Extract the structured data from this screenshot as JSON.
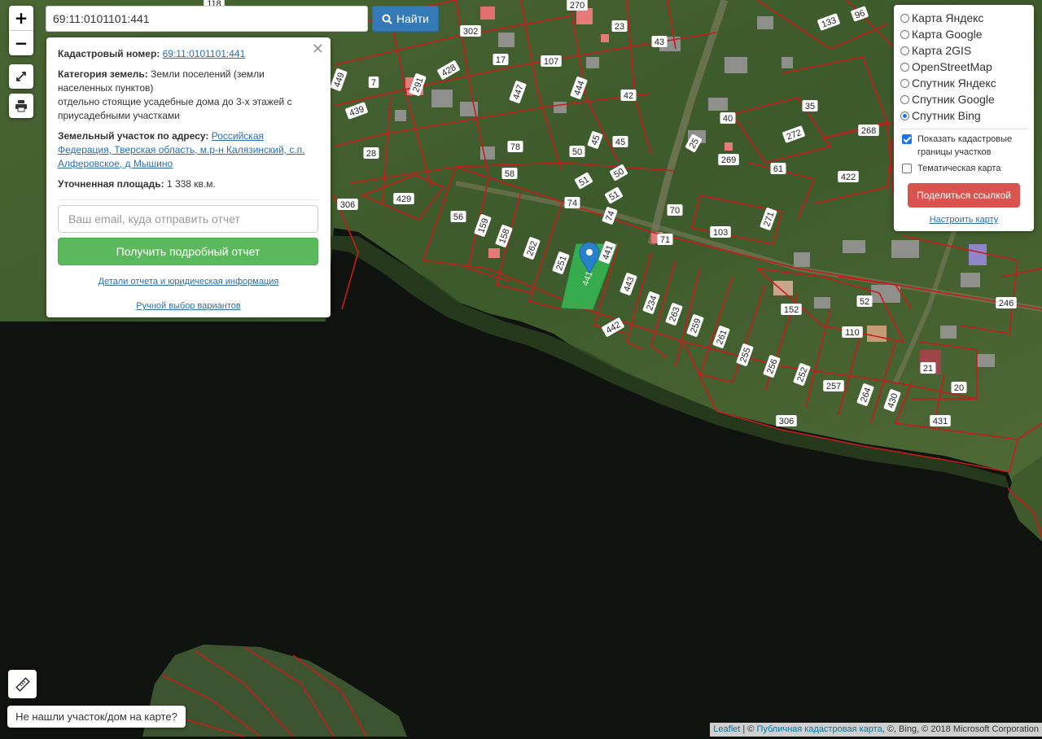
{
  "search": {
    "value": "69:11:0101101:441",
    "button_label": "Найти"
  },
  "zoom": {
    "in_label": "+",
    "out_label": "−"
  },
  "info_panel": {
    "cadastral_label": "Кадастровый номер:",
    "cadastral_value": "69:11:0101101:441",
    "category_label": "Категория земель:",
    "category_value": "Земли поселений (земли населенных пунктов)",
    "category_detail": "отдельно стоящие усадебные дома до 3-х этажей с приусадебными участками",
    "address_label": "Земельный участок по адресу:",
    "address_value": "Российская Федерация, Тверская область, м.р-н Калязинский, с.п. Алферовское, д Мышино",
    "area_label": "Уточненная площадь:",
    "area_value": "1 338 кв.м.",
    "email_placeholder": "Ваш email, куда отправить отчет",
    "report_button": "Получить подробный отчет",
    "details_link": "Детали отчета и юридическая информация",
    "manual_link": "Ручной выбор вариантов",
    "close_glyph": "✕"
  },
  "layers": {
    "options": [
      "Карта Яндекс",
      "Карта Google",
      "Карта 2GIS",
      "OpenStreetMap",
      "Спутник Яндекс",
      "Спутник Google",
      "Спутник Bing"
    ],
    "selected": "Спутник Bing",
    "show_borders_label": "Показать кадастровые границы участков",
    "show_borders": true,
    "thematic_label": "Тематическая карта",
    "thematic": false,
    "share_button": "Поделиться ссылкой",
    "setup_link": "Настроить карту"
  },
  "bottom_button": "Не нашли участок/дом на карте?",
  "attribution": {
    "leaflet": "Leaflet",
    "sep": " | © ",
    "pkk": "Публичная кадастровая карта",
    "rest": ", ©, Bing, © 2018 Microsoft Corporation"
  },
  "plot_labels": [
    "118",
    "270",
    "96",
    "133",
    "302",
    "23",
    "43",
    "428",
    "17",
    "107",
    "449",
    "7",
    "291",
    "447",
    "444",
    "42",
    "439",
    "35",
    "40",
    "78",
    "45",
    "50",
    "45",
    "268",
    "272",
    "28",
    "58",
    "50",
    "25",
    "269",
    "61",
    "51",
    "51",
    "422",
    "306",
    "429",
    "74",
    "74",
    "70",
    "271",
    "56",
    "159",
    "158",
    "262",
    "103",
    "71",
    "251",
    "441",
    "443",
    "52",
    "246",
    "234",
    "263",
    "259",
    "152",
    "261",
    "442",
    "110",
    "255",
    "256",
    "252",
    "21",
    "257",
    "20",
    "264",
    "430",
    "306",
    "431"
  ],
  "selected_plot_label": "441",
  "colors": {
    "boundary": "#cc1a1a",
    "selected_plot": "#34c75a",
    "marker": "#2a81cb",
    "water": "#111411",
    "land": "#3f5a2d"
  }
}
